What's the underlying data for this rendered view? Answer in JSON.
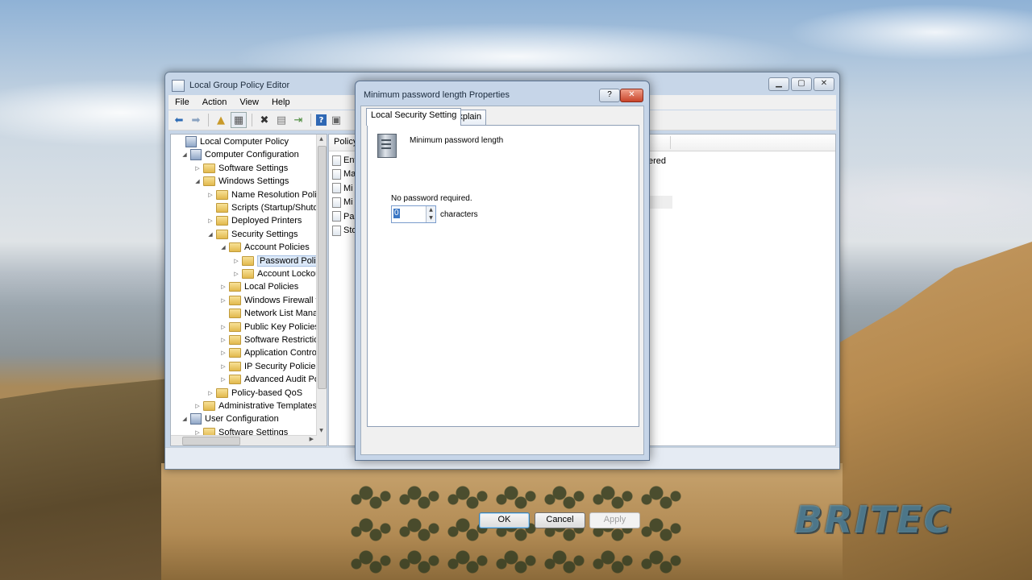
{
  "gpe": {
    "title": "Local Group Policy Editor",
    "menu": [
      "File",
      "Action",
      "View",
      "Help"
    ],
    "tree": [
      {
        "label": "Local Computer Policy",
        "level": 0,
        "exp": ""
      },
      {
        "label": "Computer Configuration",
        "level": 1,
        "exp": "◢"
      },
      {
        "label": "Software Settings",
        "level": 2,
        "exp": "▷"
      },
      {
        "label": "Windows Settings",
        "level": 2,
        "exp": "◢"
      },
      {
        "label": "Name Resolution Policy",
        "level": 3,
        "exp": "▷"
      },
      {
        "label": "Scripts (Startup/Shutdov",
        "level": 3,
        "exp": ""
      },
      {
        "label": "Deployed Printers",
        "level": 3,
        "exp": "▷"
      },
      {
        "label": "Security Settings",
        "level": 3,
        "exp": "◢"
      },
      {
        "label": "Account Policies",
        "level": 4,
        "exp": "◢"
      },
      {
        "label": "Password Policy",
        "level": 5,
        "exp": "▷",
        "selected": true
      },
      {
        "label": "Account Lockout",
        "level": 5,
        "exp": "▷"
      },
      {
        "label": "Local Policies",
        "level": 4,
        "exp": "▷"
      },
      {
        "label": "Windows Firewall wi",
        "level": 4,
        "exp": "▷"
      },
      {
        "label": "Network List Manag",
        "level": 4,
        "exp": ""
      },
      {
        "label": "Public Key Policies",
        "level": 4,
        "exp": "▷"
      },
      {
        "label": "Software Restriction",
        "level": 4,
        "exp": "▷"
      },
      {
        "label": "Application Control",
        "level": 4,
        "exp": "▷"
      },
      {
        "label": "IP Security Policies o",
        "level": 4,
        "exp": "▷"
      },
      {
        "label": "Advanced Audit Poli",
        "level": 4,
        "exp": "▷"
      },
      {
        "label": "Policy-based QoS",
        "level": 3,
        "exp": "▷"
      },
      {
        "label": "Administrative Templates",
        "level": 2,
        "exp": "▷"
      },
      {
        "label": "User Configuration",
        "level": 1,
        "exp": "◢"
      },
      {
        "label": "Software Settings",
        "level": 2,
        "exp": "▷"
      }
    ],
    "list_header": "Policy",
    "list_rows": [
      "Enf",
      "Ma",
      "Mi",
      "Mi",
      "Pas",
      "Sto"
    ],
    "right_fragment": "ered"
  },
  "dialog": {
    "title": "Minimum password length Properties",
    "help_label": "?",
    "close_label": "✕",
    "tabs": [
      "Local Security Setting",
      "Explain"
    ],
    "policy_name": "Minimum password length",
    "status_text": "No password required.",
    "length_value": "0",
    "unit_label": "characters",
    "buttons": {
      "ok": "OK",
      "cancel": "Cancel",
      "apply": "Apply"
    }
  },
  "watermark": "BRITEC"
}
